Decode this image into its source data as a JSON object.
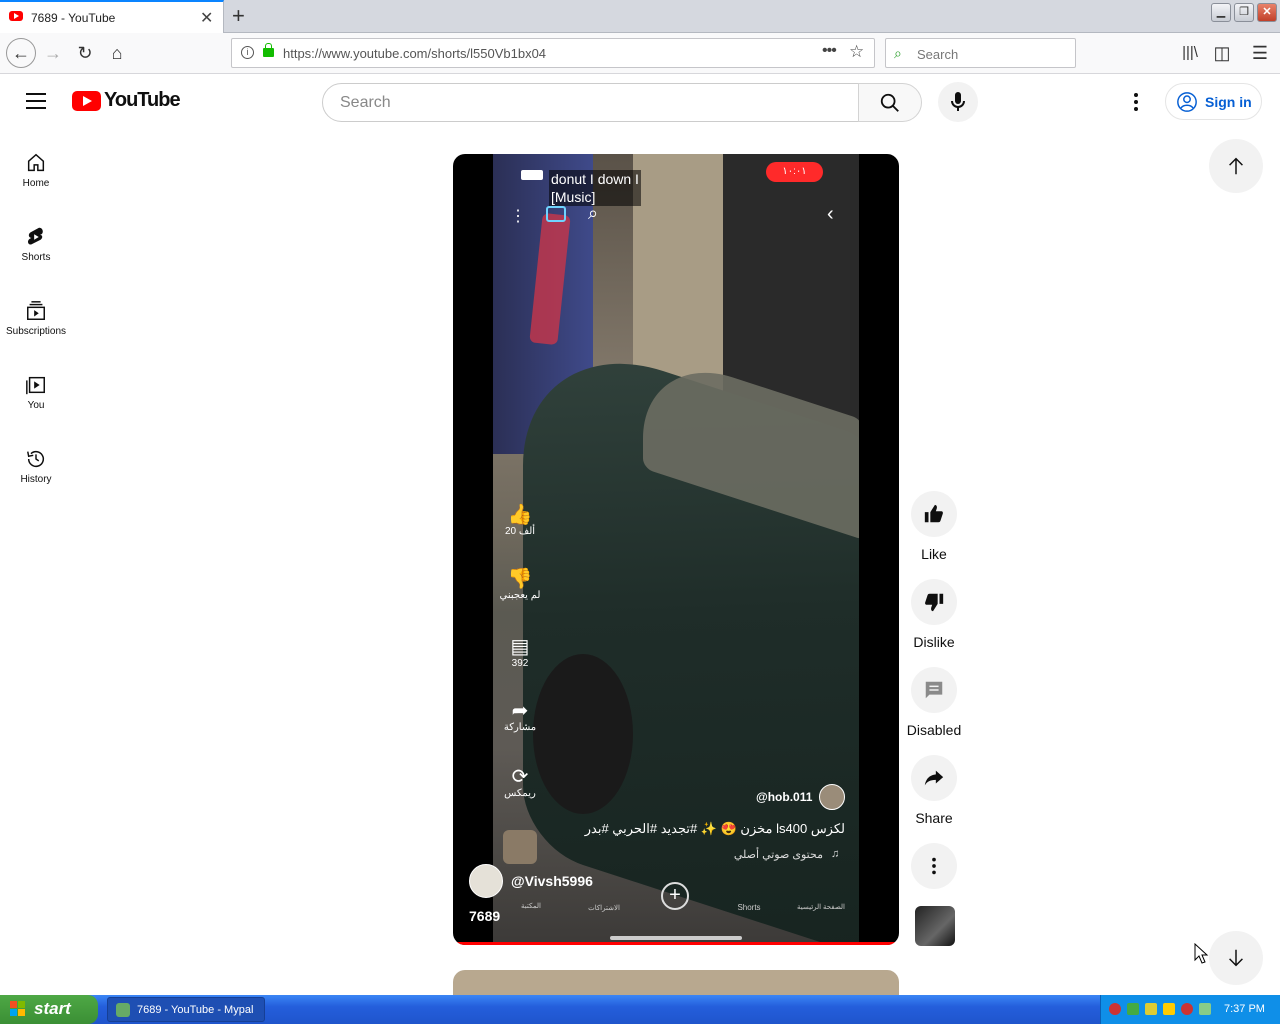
{
  "browser": {
    "tab_title": "7689 - YouTube",
    "url": "https://www.youtube.com/shorts/l550Vb1bx04",
    "search_placeholder": "Search"
  },
  "youtube": {
    "logo_text": "YouTube",
    "search_placeholder": "Search",
    "signin_label": "Sign in"
  },
  "sidebar": {
    "items": [
      {
        "label": "Home",
        "icon": "home-icon"
      },
      {
        "label": "Shorts",
        "icon": "shorts-icon"
      },
      {
        "label": "Subscriptions",
        "icon": "subscriptions-icon"
      },
      {
        "label": "You",
        "icon": "you-icon"
      },
      {
        "label": "History",
        "icon": "history-icon"
      }
    ]
  },
  "video": {
    "channel": "@Vivsh5996",
    "title": "7689",
    "embedded": {
      "music_tag_line1": "donut I down I",
      "music_tag_line2": "[Music]",
      "timer": "١٠:٠١",
      "like_count": "20 ألف",
      "dislike_label": "لم يعجبني",
      "comment_count": "392",
      "share_label": "مشاركة",
      "remix_label": "ريمكس",
      "author": "@hob.011",
      "caption": "لكزس ls400 مخزن 😍 ✨ #تجديد #الحربي #بدر",
      "audio": "محتوى صوتي أصلي",
      "nav": [
        "المكتبة",
        "الاشتراكات",
        "",
        "Shorts",
        "الصفحة الرئيسية"
      ]
    },
    "progress": 1.0
  },
  "actions": {
    "like": "Like",
    "dislike": "Dislike",
    "comments": "Disabled",
    "share": "Share"
  },
  "taskbar": {
    "start_label": "start",
    "window_item": "7689 - YouTube - Mypal",
    "clock": "7:37 PM"
  }
}
